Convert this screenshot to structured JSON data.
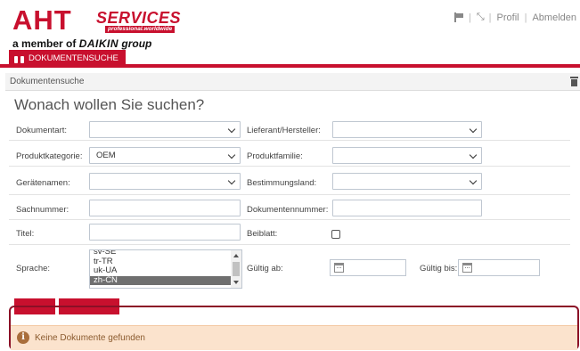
{
  "header": {
    "logo_aht": "AHT",
    "logo_services": "SERVICES",
    "logo_tagline": "professional.worldwide",
    "logo_member_prefix": "a member of",
    "logo_daikin": "DAIKIN",
    "logo_group": "group",
    "nav": {
      "flag_icon": "flag-icon",
      "expand_icon": "expand-icon",
      "profile": "Profil",
      "logout": "Abmelden"
    }
  },
  "tabs": [
    {
      "label": "DOKUMENTENSUCHE",
      "icon": "binoculars-icon",
      "active": true
    }
  ],
  "panel": {
    "title": "Dokumentensuche",
    "heading": "Wonach wollen Sie suchen?"
  },
  "form": {
    "dokumentart": {
      "label": "Dokumentart:",
      "value": ""
    },
    "lieferant": {
      "label": "Lieferant/Hersteller:",
      "value": ""
    },
    "produktkategorie": {
      "label": "Produktkategorie:",
      "value": "OEM"
    },
    "produktfamilie": {
      "label": "Produktfamilie:",
      "value": ""
    },
    "geraetenamen": {
      "label": "Gerätenamen:",
      "value": ""
    },
    "bestimmungsland": {
      "label": "Bestimmungsland:",
      "value": ""
    },
    "sachnummer": {
      "label": "Sachnummer:",
      "value": ""
    },
    "dokumentennummer": {
      "label": "Dokumentennummer:",
      "value": ""
    },
    "titel": {
      "label": "Titel:",
      "value": ""
    },
    "beiblatt": {
      "label": "Beiblatt:",
      "checked": false
    },
    "sprache": {
      "label": "Sprache:",
      "options": [
        "sv-SE",
        "tr-TR",
        "uk-UA",
        "zh-CN"
      ],
      "selected": "zh-CN"
    },
    "gueltig_ab": {
      "label": "Gültig ab:",
      "value": ""
    },
    "gueltig_bis": {
      "label": "Gültig bis:",
      "value": ""
    }
  },
  "message": {
    "text": "Keine Dokumente gefunden",
    "icon": "info-icon"
  },
  "colors": {
    "brand_red": "#c8102e",
    "alert_bg": "#fbe3cd"
  }
}
